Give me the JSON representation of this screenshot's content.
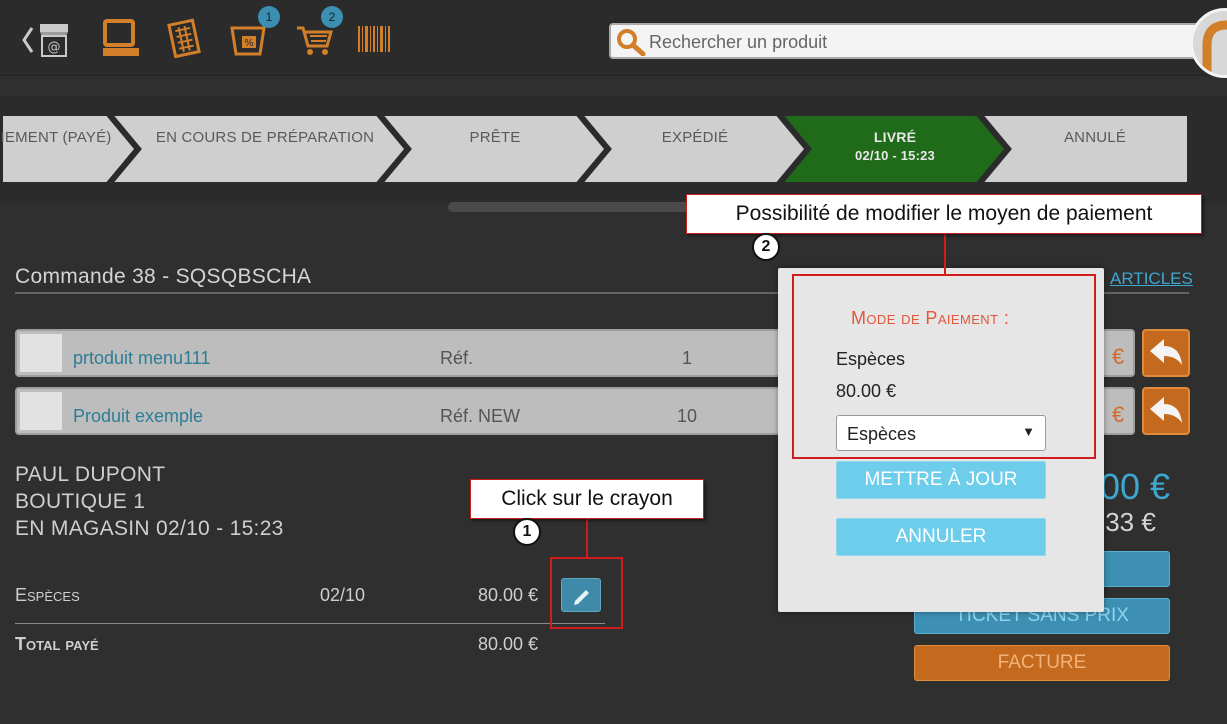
{
  "colors": {
    "accent_orange": "#d27f2a",
    "accent_blue": "#3fa6cf",
    "active_step": "#1f6b1a",
    "annotation_red": "#d01c1c"
  },
  "toolbar": {
    "icons": [
      "back-shop-icon",
      "register-icon",
      "catalog-icon",
      "discount-icon",
      "cart-icon",
      "barcode-icon"
    ],
    "discount_badge": "1",
    "cart_badge": "2",
    "search_placeholder": "Rechercher un produit"
  },
  "steps": [
    {
      "label": "IEMENT (PAYÉ)"
    },
    {
      "label": "EN COURS DE PRÉPARATION"
    },
    {
      "label": "PRÊTE"
    },
    {
      "label": "EXPÉDIÉ"
    },
    {
      "label": "LIVRÉ",
      "sub": "02/10 - 15:23",
      "active": true
    },
    {
      "label": "ANNULÉ"
    }
  ],
  "order": {
    "title": "Commande 38 - SQSQBSCHA",
    "articles_link": "ARTICLES"
  },
  "products": [
    {
      "name": "prtoduit menu111",
      "ref": "Réf.",
      "qty": "1",
      "currency": "€"
    },
    {
      "name": "Produit exemple",
      "ref": "Réf. NEW",
      "qty": "10",
      "currency": "€"
    }
  ],
  "customer": {
    "name": "PAUL DUPONT",
    "shop": "BOUTIQUE 1",
    "mode": "EN MAGASIN 02/10 - 15:23"
  },
  "payment": {
    "method": "Espèces",
    "date": "02/10",
    "amount": "80.00 €",
    "total_label": "Total payé",
    "total_amount": "80.00 €"
  },
  "totals": {
    "big": "00 €",
    "small": ".33 €"
  },
  "side_buttons": {
    "ticket_no_price": "TICKET SANS PRIX",
    "invoice": "FACTURE"
  },
  "modal": {
    "title": "Mode de Paiement :",
    "method": "Espèces",
    "amount": "80.00 €",
    "select_value": "Espèces",
    "update_button": "METTRE À JOUR",
    "cancel_button": "ANNULER"
  },
  "annotations": {
    "callout1": "Click sur le crayon",
    "number1": "1",
    "callout2": "Possibilité de modifier le moyen de paiement",
    "number2": "2"
  }
}
